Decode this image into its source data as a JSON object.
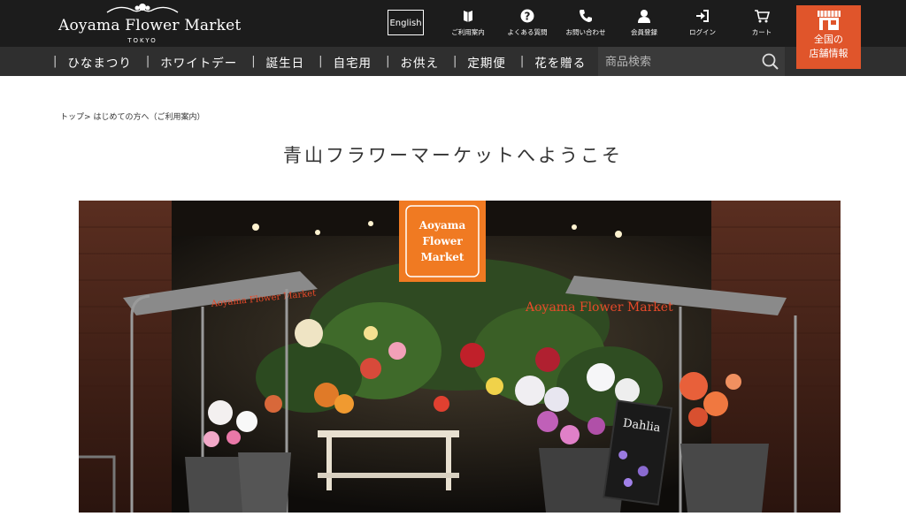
{
  "header": {
    "logo": {
      "name": "Aoyama Flower Market",
      "sub": "TOKYO"
    },
    "language_label": "English",
    "nav": [
      {
        "label": "ご利用案内",
        "icon": "info-icon"
      },
      {
        "label": "よくある質問",
        "icon": "question-icon"
      },
      {
        "label": "お問い合わせ",
        "icon": "phone-icon"
      },
      {
        "label": "会員登録",
        "icon": "user-icon"
      },
      {
        "label": "ログイン",
        "icon": "login-icon"
      },
      {
        "label": "カート",
        "icon": "cart-icon"
      }
    ],
    "stores": {
      "line1": "全国の",
      "line2": "店舗情報",
      "icon": "store-icon"
    }
  },
  "categories": [
    "ひなまつり",
    "ホワイトデー",
    "誕生日",
    "自宅用",
    "お供え",
    "定期便",
    "花を贈る"
  ],
  "search": {
    "placeholder": "商品検索"
  },
  "breadcrumb": {
    "home": "トップ",
    "sep": ">",
    "current": "はじめての方へ（ご利用案内）"
  },
  "page_title": "青山フラワーマーケットへようこそ",
  "hero": {
    "sign_text": [
      "Aoyama",
      "Flower",
      "Market"
    ],
    "awning_text": "Aoyama Flower Market",
    "chalkboard_text": "Dahlia",
    "colors": {
      "accent": "#e0552b",
      "topbar": "#1c1c1c",
      "catbar": "#2f2f2f",
      "sign": "#f07a22"
    }
  }
}
